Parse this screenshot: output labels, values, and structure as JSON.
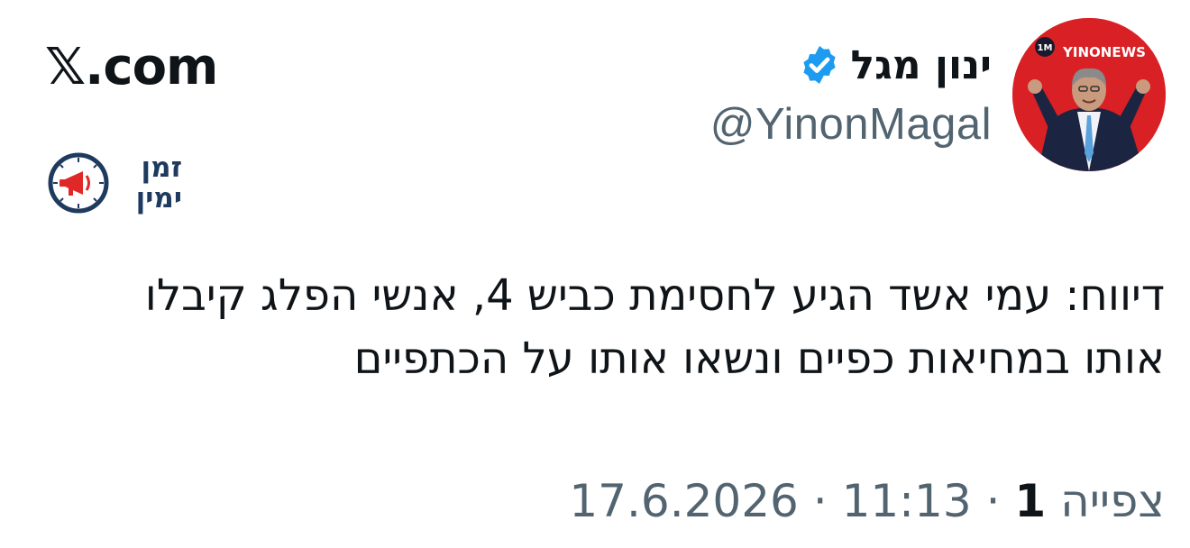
{
  "site": {
    "brand": "𝕏.com",
    "logo_text_line1": "זמן",
    "logo_text_line2": "ימין"
  },
  "author": {
    "display_name": "ינון מגל",
    "handle": "@YinonMagal",
    "avatar_badge": "1M",
    "avatar_text": "YINONEWS",
    "verified": true
  },
  "tweet": {
    "text": "דיווח: עמי אשד הגיע לחסימת כביש 4, אנשי הפלג קיבלו אותו במחיאות כפיים ונשאו אותו על הכתפיים"
  },
  "meta": {
    "date": "17.6.2026",
    "sep": "·",
    "time": "11:13",
    "views_label": "צפייה",
    "views_count": "1"
  },
  "colors": {
    "verified_blue": "#1d9bf0",
    "avatar_red": "#d92024",
    "logo_navy": "#1e3a5f"
  },
  "icons": {
    "verified": "verified-badge-icon",
    "logo": "megaphone-clock-icon"
  }
}
